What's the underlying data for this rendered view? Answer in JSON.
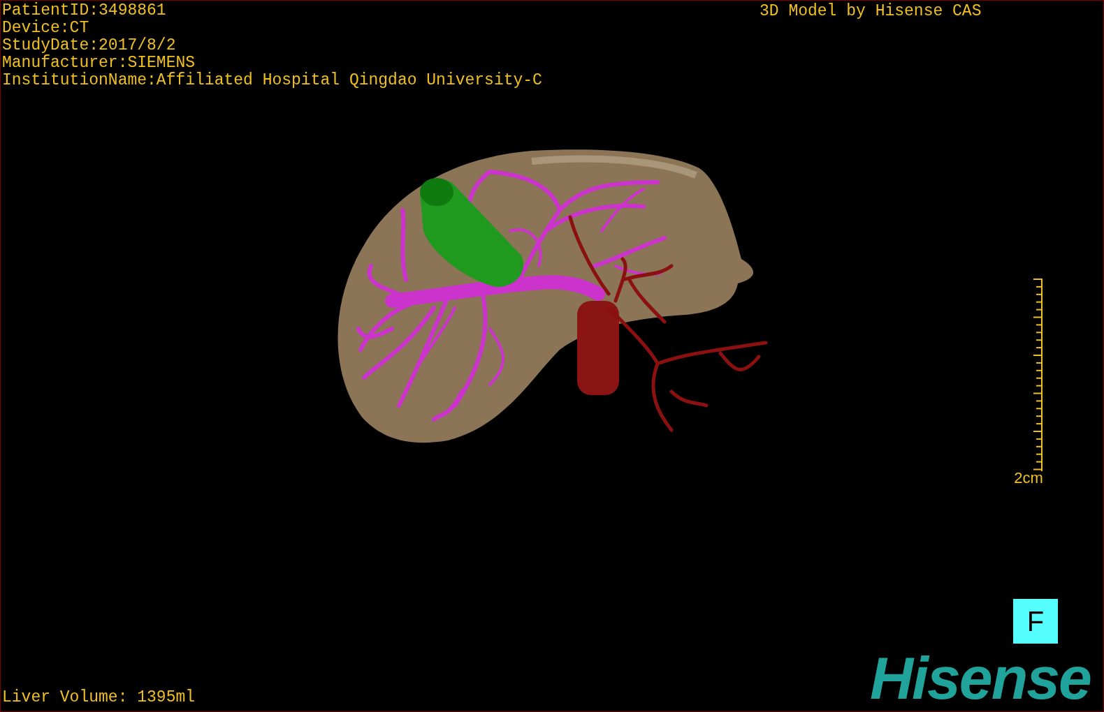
{
  "info_lines": [
    "PatientID:3498861",
    "Device:CT",
    "StudyDate:2017/8/2",
    "Manufacturer:SIEMENS",
    "InstitutionName:Affiliated Hospital Qingdao University-C"
  ],
  "header_right": "3D Model by Hisense CAS",
  "scale_bar": {
    "label": "2cm"
  },
  "orientation_button": "F",
  "logo": "Hisense",
  "footer": "Liver Volume: 1395ml"
}
